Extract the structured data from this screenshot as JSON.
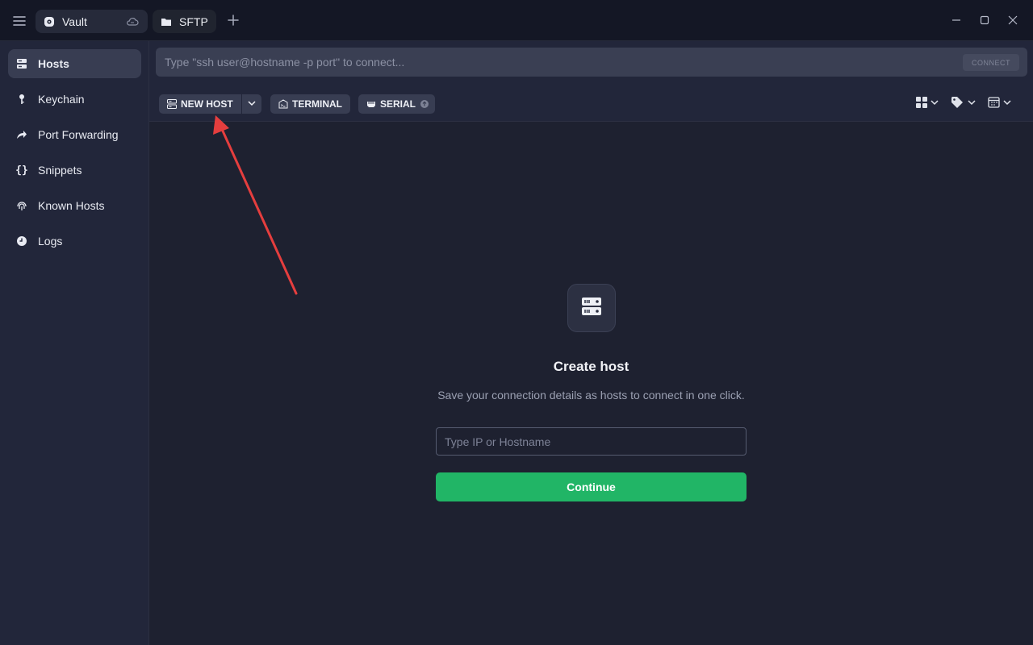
{
  "titlebar": {
    "tabs": [
      {
        "label": "Vault",
        "icon": "vault-icon",
        "sync_icon": "cloud-icon"
      },
      {
        "label": "SFTP",
        "icon": "folder-icon"
      }
    ],
    "add_tab_icon": "plus-icon",
    "window_controls": [
      "minimize-icon",
      "maximize-icon",
      "close-icon"
    ]
  },
  "sidebar": {
    "items": [
      {
        "label": "Hosts",
        "icon": "hosts-icon",
        "active": true
      },
      {
        "label": "Keychain",
        "icon": "key-icon",
        "active": false
      },
      {
        "label": "Port Forwarding",
        "icon": "forward-arrow-icon",
        "active": false
      },
      {
        "label": "Snippets",
        "icon": "braces-icon",
        "active": false
      },
      {
        "label": "Known Hosts",
        "icon": "fingerprint-icon",
        "active": false
      },
      {
        "label": "Logs",
        "icon": "clock-icon",
        "active": false
      }
    ]
  },
  "connect_bar": {
    "placeholder": "Type \"ssh user@hostname -p port\" to connect...",
    "button_label": "CONNECT"
  },
  "toolbar": {
    "new_host_label": "NEW HOST",
    "terminal_label": "TERMINAL",
    "serial_label": "SERIAL",
    "view_icons": [
      "grid-view-icon",
      "tag-icon",
      "calendar-icon"
    ]
  },
  "empty_state": {
    "title": "Create host",
    "subtitle": "Save your connection details as hosts to connect in one click.",
    "input_placeholder": "Type IP or Hostname",
    "continue_label": "Continue"
  },
  "colors": {
    "accent_green": "#21b566",
    "annotation_arrow": "#e53e3e",
    "background": "#1e2130",
    "sidebar": "#22263a"
  }
}
